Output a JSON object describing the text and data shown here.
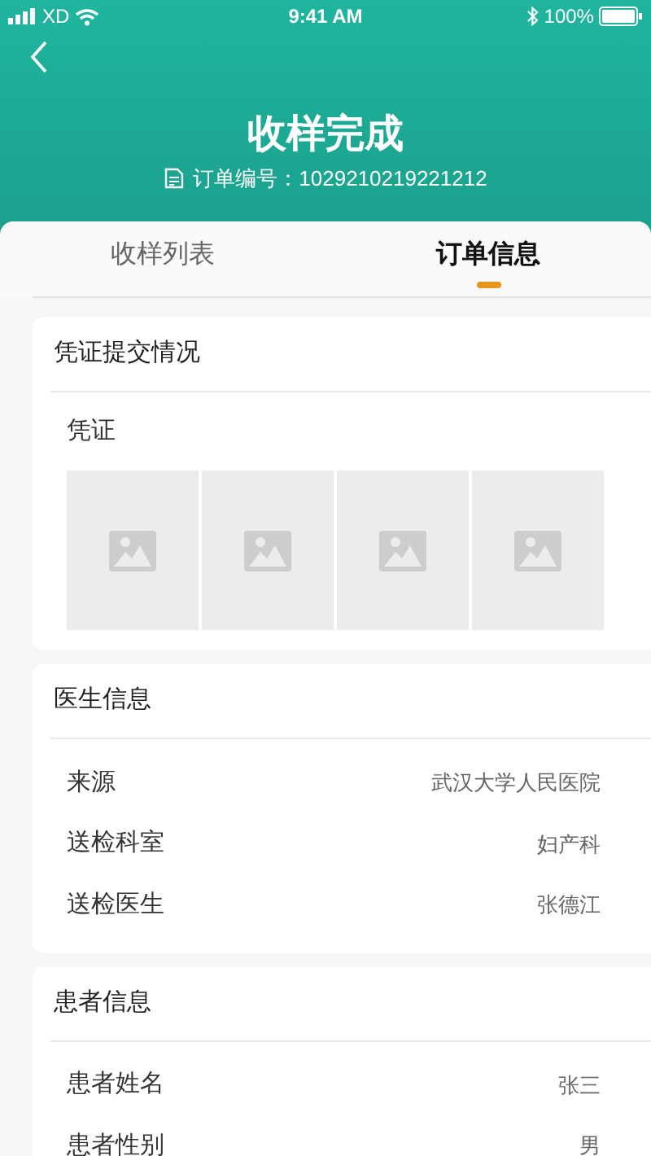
{
  "status_bar": {
    "carrier": "XD",
    "time": "9:41 AM",
    "battery": "100%"
  },
  "header": {
    "title": "收样完成",
    "order_label": "订单编号：",
    "order_number": "1029210219221212"
  },
  "tabs": [
    {
      "label": "收样列表",
      "selected": false
    },
    {
      "label": "订单信息",
      "selected": true
    }
  ],
  "voucher_section": {
    "title": "凭证提交情况",
    "label": "凭证",
    "images": [
      {
        "kind": "placeholder"
      },
      {
        "kind": "placeholder"
      },
      {
        "kind": "placeholder"
      },
      {
        "kind": "placeholder"
      }
    ]
  },
  "sections": [
    {
      "title": "医生信息",
      "rows": [
        {
          "label": "来源",
          "value": "武汉大学人民医院"
        },
        {
          "label": "送检科室",
          "value": "妇产科"
        },
        {
          "label": "送检医生",
          "value": "张德江"
        }
      ]
    },
    {
      "title": "患者信息",
      "rows": [
        {
          "label": "患者姓名",
          "value": "张三"
        },
        {
          "label": "患者性别",
          "value": "男"
        }
      ]
    }
  ]
}
